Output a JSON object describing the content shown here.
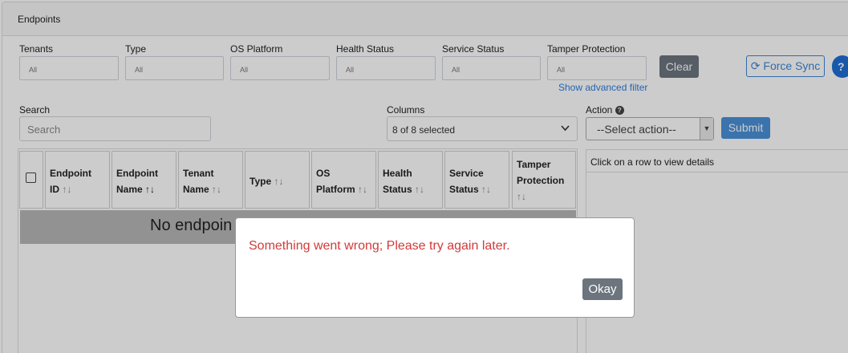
{
  "panel": {
    "title": "Endpoints"
  },
  "filters": [
    {
      "label": "Tenants",
      "value": "All"
    },
    {
      "label": "Type",
      "value": "All"
    },
    {
      "label": "OS Platform",
      "value": "All"
    },
    {
      "label": "Health Status",
      "value": "All"
    },
    {
      "label": "Service Status",
      "value": "All"
    },
    {
      "label": "Tamper Protection",
      "value": "All"
    }
  ],
  "buttons": {
    "clear": "Clear",
    "force_sync": "Force Sync",
    "help": "?",
    "submit": "Submit",
    "okay": "Okay"
  },
  "advanced_filter_link": "Show advanced filter",
  "search": {
    "label": "Search",
    "placeholder": "Search"
  },
  "columns": {
    "label": "Columns",
    "selected": "8 of 8 selected"
  },
  "action": {
    "label": "Action",
    "selected": "--Select action--"
  },
  "table": {
    "headers": [
      {
        "line1": "Endpoint",
        "line2": "ID",
        "sort": "↑↓"
      },
      {
        "line1": "Endpoint",
        "line2": "Name",
        "sort": "↑↓"
      },
      {
        "line1": "Tenant",
        "line2": "Name",
        "sort": "↑↓"
      },
      {
        "line1": "Type",
        "line2": "",
        "sort": "↑↓"
      },
      {
        "line1": "OS",
        "line2": "Platform",
        "sort": "↑↓"
      },
      {
        "line1": "Health",
        "line2": "Status",
        "sort": "↑↓"
      },
      {
        "line1": "Service",
        "line2": "Status",
        "sort": "↑↓"
      },
      {
        "line1": "Tamper",
        "line2": "Protection",
        "sort": "↑↓"
      }
    ],
    "empty_text": "No endpoin"
  },
  "detail": {
    "hint": "Click on a row to view details"
  },
  "modal": {
    "message": "Something went wrong; Please try again later."
  }
}
